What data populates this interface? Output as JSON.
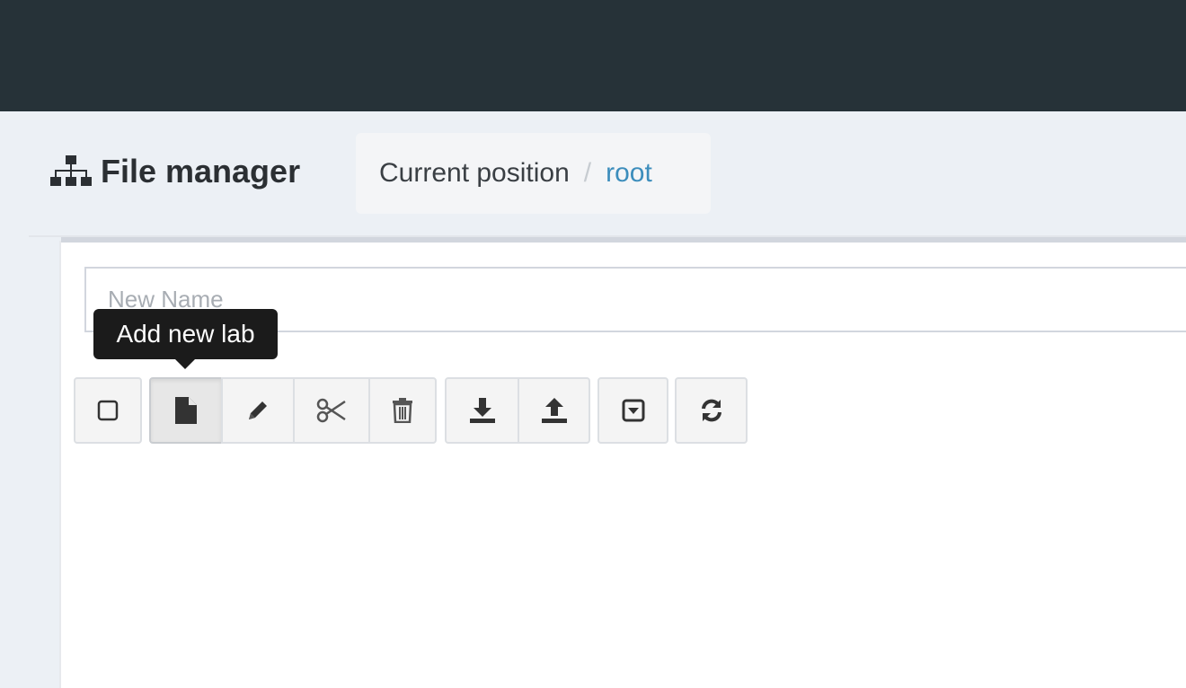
{
  "header": {
    "title": "File manager",
    "title_icon": "sitemap-icon"
  },
  "breadcrumb": {
    "label": "Current position",
    "separator": "/",
    "current": "root"
  },
  "name_input": {
    "placeholder": "New Name",
    "value": ""
  },
  "tooltip": {
    "text": "Add new lab"
  },
  "toolbar": {
    "buttons": [
      {
        "name": "select-all",
        "icon": "checkbox-icon"
      },
      {
        "name": "add-new-lab",
        "icon": "file-icon"
      },
      {
        "name": "rename",
        "icon": "pencil-icon"
      },
      {
        "name": "cut",
        "icon": "scissors-icon"
      },
      {
        "name": "delete",
        "icon": "trash-icon"
      },
      {
        "name": "export",
        "icon": "download-icon"
      },
      {
        "name": "import",
        "icon": "upload-icon"
      },
      {
        "name": "filter",
        "icon": "dropdown-box-icon"
      },
      {
        "name": "refresh",
        "icon": "refresh-icon"
      }
    ]
  },
  "colors": {
    "topbar": "#263238",
    "background": "#ecf0f5",
    "link": "#3c8dbc",
    "tooltip_bg": "#1b1b1b"
  }
}
